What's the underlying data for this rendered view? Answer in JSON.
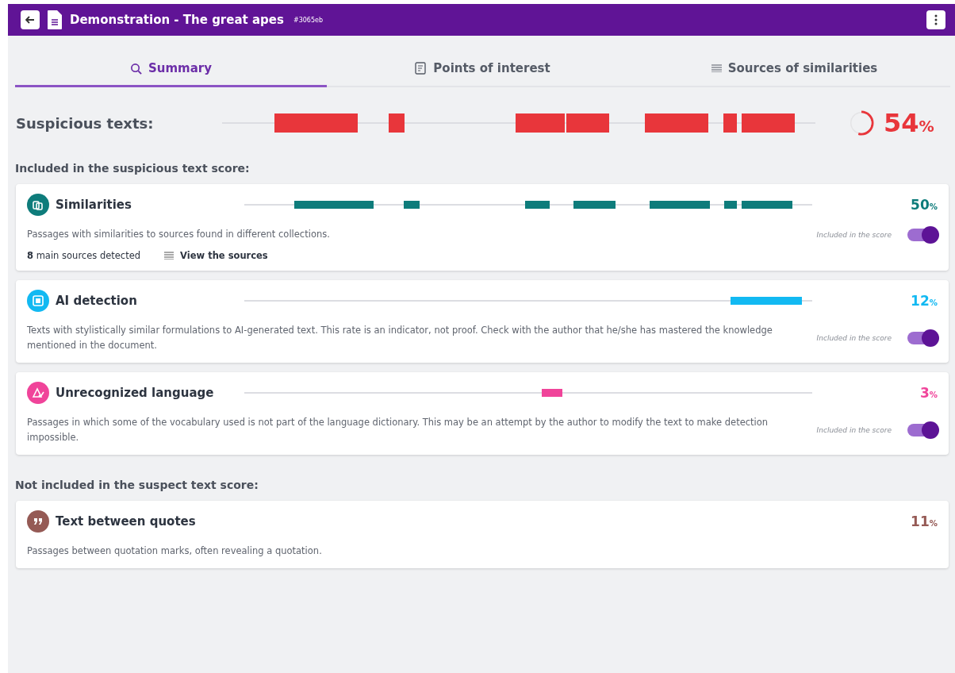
{
  "header": {
    "title": "Demonstration - The great apes",
    "id": "#3065eb"
  },
  "tabs": [
    {
      "label": "Summary",
      "kind": "search",
      "selected": true
    },
    {
      "label": "Points of interest",
      "kind": "doc",
      "selected": false
    },
    {
      "label": "Sources of similarities",
      "kind": "list",
      "selected": false
    }
  ],
  "suspicious": {
    "label": "Suspicious texts:",
    "level": 0.54,
    "value": "54",
    "unit": "%"
  },
  "included_heading": "Included in the suspicious text score:",
  "included": [
    {
      "kind": "similarity",
      "title": "Similarities",
      "color": "#0e7c7b",
      "value": "50",
      "unit": "%",
      "description": "Passages with similarities to sources found in different collections.",
      "toggle_label": "Included in the score",
      "on": true,
      "sources_count": "8",
      "sources_text": "main sources detected",
      "sources_link": "View the sources"
    },
    {
      "kind": "ai",
      "title": "AI detection",
      "color": "#12b9f2",
      "value": "12",
      "unit": "%",
      "description": "Texts with stylistically similar formulations to AI-generated text. This rate is an indicator, not proof. Check with the author that he/she has mastered the knowledge mentioned in the document.",
      "toggle_label": "Included in the score",
      "on": true
    },
    {
      "kind": "language",
      "title": "Unrecognized language",
      "color": "#f0449a",
      "value": "3",
      "unit": "%",
      "description": "Passages in which some of the vocabulary used is not part of the language dictionary. This may be an attempt by the author to modify the text to make detection impossible.",
      "toggle_label": "Included in the score",
      "on": true
    }
  ],
  "excluded_heading": "Not included in the suspect text score:",
  "excluded": [
    {
      "kind": "quotes",
      "title": "Text between quotes",
      "color": "#955a55",
      "value": "11",
      "unit": "%",
      "description": "Passages between quotation marks, often revealing a quotation."
    }
  ]
}
